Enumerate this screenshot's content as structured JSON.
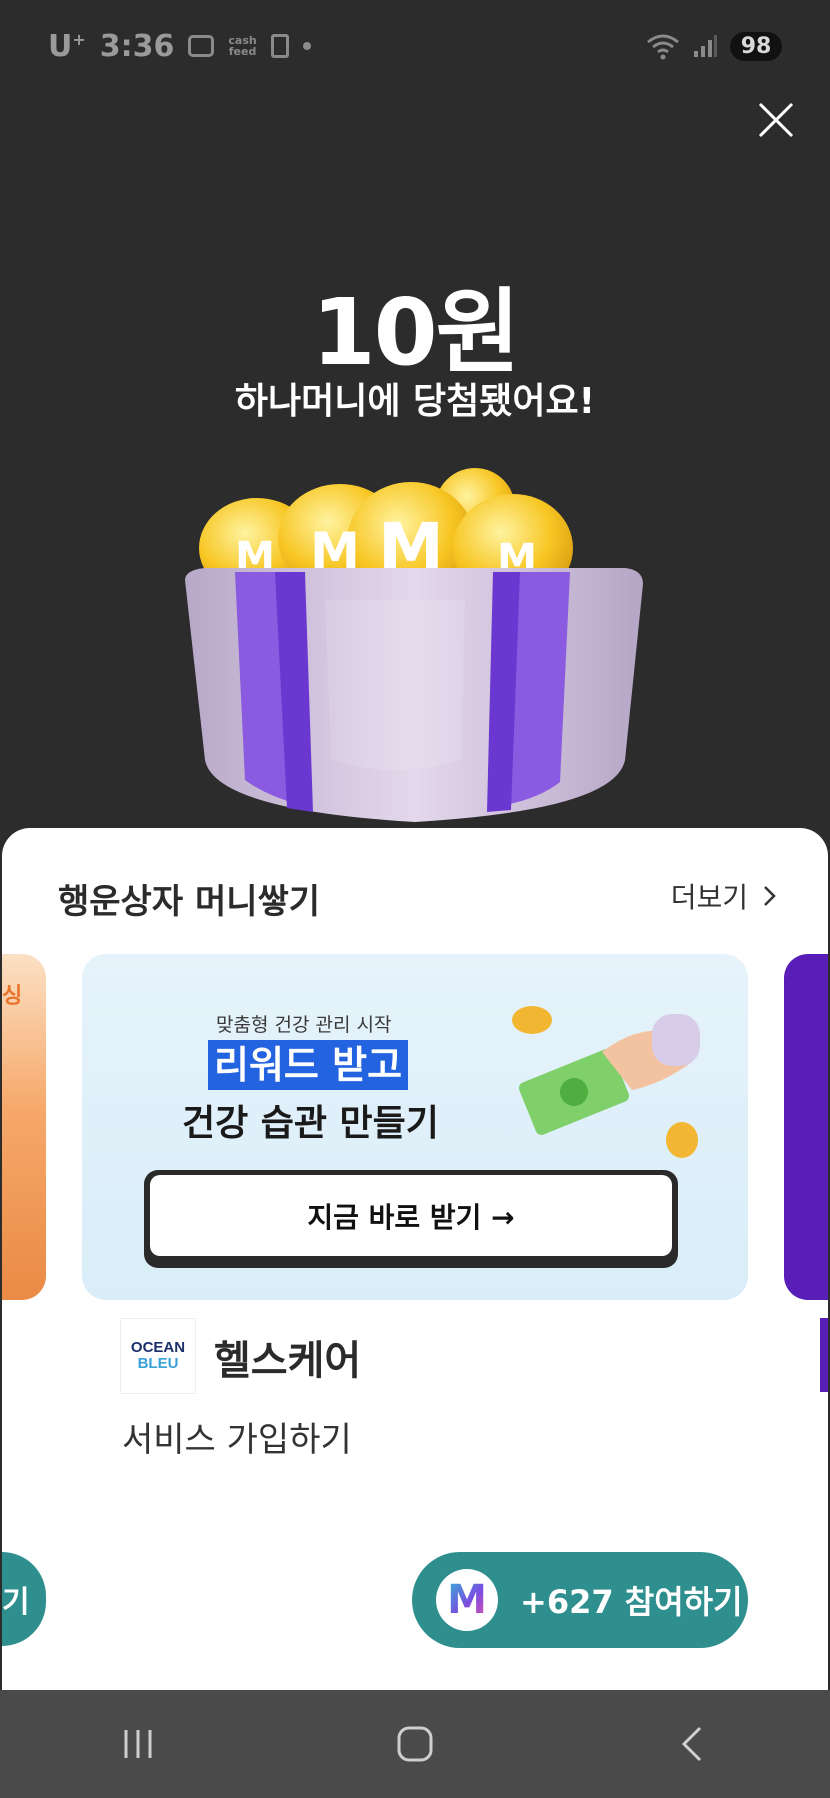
{
  "status_bar": {
    "carrier": "U",
    "carrier_sup": "+",
    "time": "3:36",
    "cashfeed_line1": "cash",
    "cashfeed_line2": "feed",
    "battery": "98"
  },
  "prize": {
    "amount": "10원",
    "message": "하나머니에 당첨됐어요!"
  },
  "sheet": {
    "title": "행운상자 머니쌓기",
    "more_label": "더보기",
    "left_peek_text": "싱",
    "left_peek_button": "기",
    "banner": {
      "subtitle": "맞춤형 건강 관리 시작",
      "headline_highlight": "리워드 받고",
      "headline": "건강 습관 만들기",
      "cta": "지금 바로 받기 →"
    },
    "brand": {
      "logo_line1": "OCEAN",
      "logo_line2": "BLEU",
      "name": "헬스케어",
      "action": "서비스 가입하기"
    },
    "join": {
      "badge": "M",
      "label": "+627 참여하기"
    }
  },
  "colors": {
    "background": "#2c2c2c",
    "accent_teal": "#2f8f8f",
    "purple": "#5a1eb8",
    "highlight_blue": "#2463e0"
  }
}
